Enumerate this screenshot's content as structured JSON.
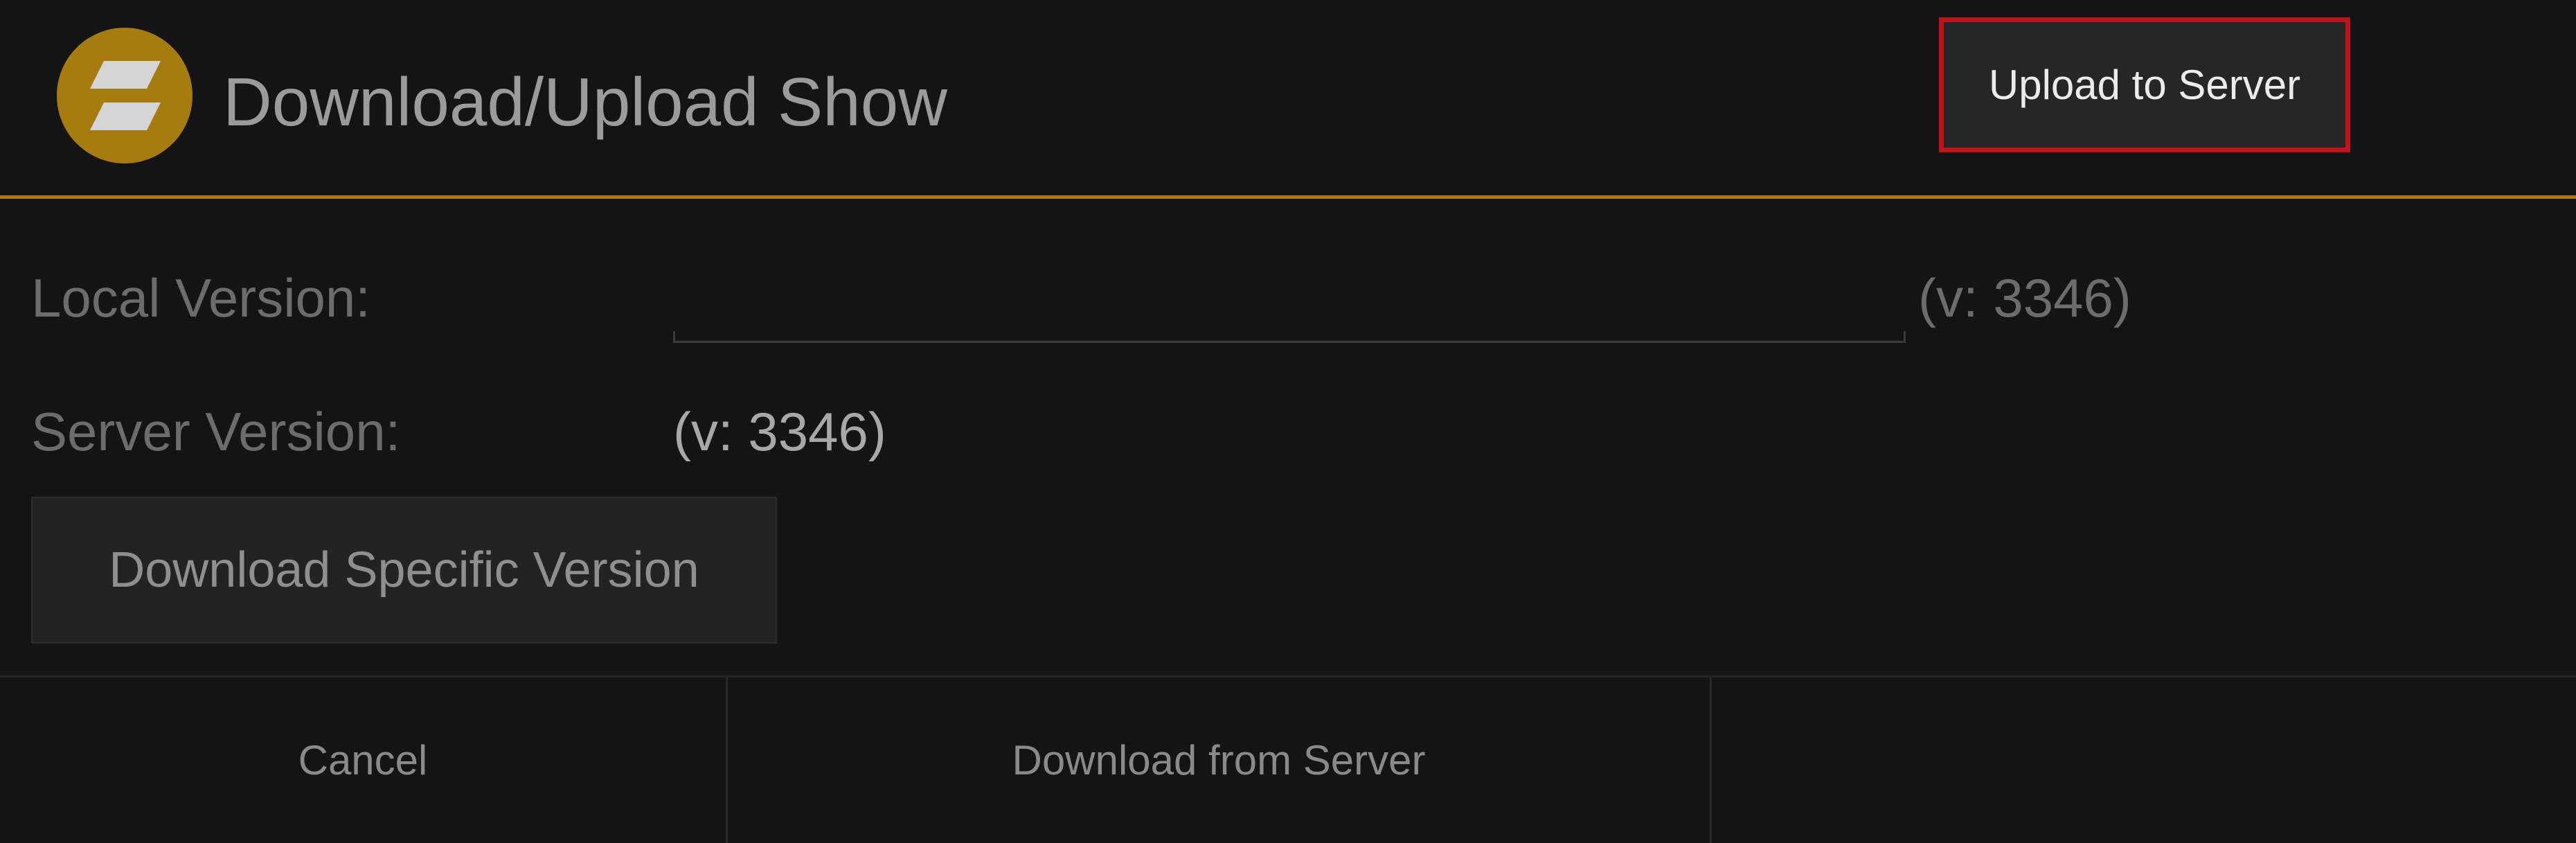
{
  "dialog": {
    "title": "Download/Upload Show",
    "logo_icon": "app-logo-icon",
    "accent_color": "#b07a12"
  },
  "versions": {
    "local_label": "Local Version:",
    "local_field_value": "",
    "local_version": "(v: 3346)",
    "server_label": "Server Version:",
    "server_version": "(v: 3346)"
  },
  "actions": {
    "download_specific_label": "Download Specific Version",
    "cancel_label": "Cancel",
    "download_label": "Download from Server",
    "upload_label": "Upload to Server",
    "highlight_color": "#c0121b"
  }
}
